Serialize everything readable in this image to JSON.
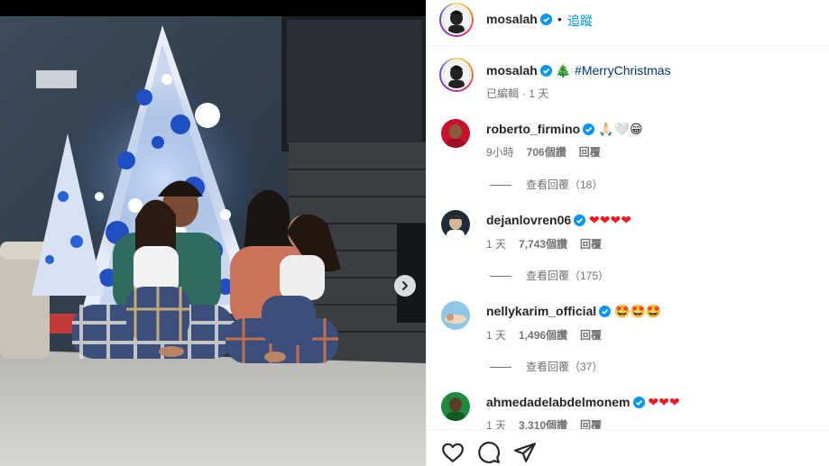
{
  "post": {
    "author": "mosalah",
    "follow_label": "追蹤",
    "dot": "•",
    "caption_hashtag": "#MerryChristmas",
    "caption_emoji": "🎄",
    "edited_label": "已編輯",
    "time": "1 天"
  },
  "comments": [
    {
      "username": "roberto_firmino",
      "text": "🙏🏻🤍😁",
      "time": "9小時",
      "likes": "706個讚",
      "reply_label": "回覆",
      "view_replies": "查看回覆（18）"
    },
    {
      "username": "dejanlovren06",
      "text": "❤❤❤❤",
      "time": "1 天",
      "likes": "7,743個讚",
      "reply_label": "回覆",
      "view_replies": "查看回覆（175）"
    },
    {
      "username": "nellykarim_official",
      "text": "🤩🤩🤩",
      "time": "1 天",
      "likes": "1,496個讚",
      "reply_label": "回覆",
      "view_replies": "查看回覆（37）"
    },
    {
      "username": "ahmedadelabdelmonem",
      "text": "❤❤❤",
      "time": "1 天",
      "likes": "3,310個讚",
      "reply_label": "回覆"
    }
  ],
  "icons": {
    "verified": "verified-badge-icon",
    "like": "heart-icon",
    "comment": "comment-icon",
    "share": "paper-plane-icon",
    "next": "chevron-right-icon"
  },
  "colors": {
    "accent": "#0095f6",
    "verified": "#0095f6",
    "heart": "#ed1c24",
    "hashtag": "#00376b",
    "muted": "#737373"
  }
}
